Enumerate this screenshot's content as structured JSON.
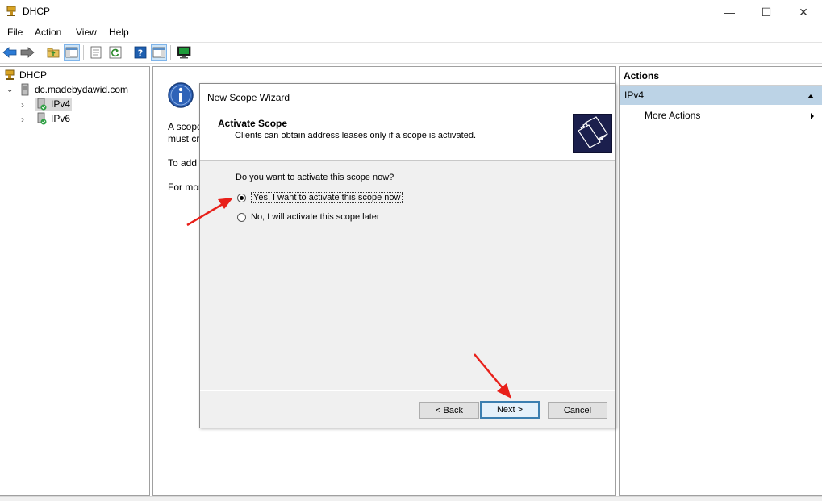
{
  "window": {
    "title": "DHCP",
    "minimize_glyph": "—",
    "maximize_glyph": "☐",
    "close_glyph": "✕"
  },
  "menu": {
    "items": [
      {
        "label": "File"
      },
      {
        "label": "Action"
      },
      {
        "label": "View"
      },
      {
        "label": "Help"
      }
    ]
  },
  "toolbar": {
    "buttons": [
      {
        "icon": "back-arrow-icon"
      },
      {
        "icon": "forward-arrow-icon"
      },
      {
        "icon": "up-folder-icon"
      },
      {
        "icon": "show-hide-console-tree-icon"
      },
      {
        "icon": "properties-icon"
      },
      {
        "icon": "refresh-icon"
      },
      {
        "icon": "help-icon"
      },
      {
        "icon": "show-hide-action-pane-icon"
      },
      {
        "icon": "monitor-icon"
      }
    ]
  },
  "tree": {
    "root": "DHCP",
    "server": "dc.madebydawid.com",
    "children": [
      {
        "label": "IPv4",
        "selected": true
      },
      {
        "label": "IPv6",
        "selected": false
      }
    ]
  },
  "center": {
    "lines": [
      "A scope",
      "must cr",
      "To add",
      "For mor"
    ]
  },
  "wizard": {
    "title": "New Scope Wizard",
    "heading": "Activate Scope",
    "subheading": "Clients can obtain address leases only if a scope is activated.",
    "question": "Do you want to activate this scope now?",
    "options": [
      {
        "label": "Yes, I want to activate this scope now",
        "checked": true
      },
      {
        "label": "No, I will activate this scope later",
        "checked": false
      }
    ],
    "back_label": "< Back",
    "next_label": "Next >",
    "cancel_label": "Cancel"
  },
  "actions": {
    "title": "Actions",
    "section": "IPv4",
    "items": [
      {
        "label": "More Actions"
      }
    ]
  },
  "colors": {
    "accent": "#3c7fb1",
    "selection": "#bcd3e6",
    "annotation": "#e8201a"
  }
}
